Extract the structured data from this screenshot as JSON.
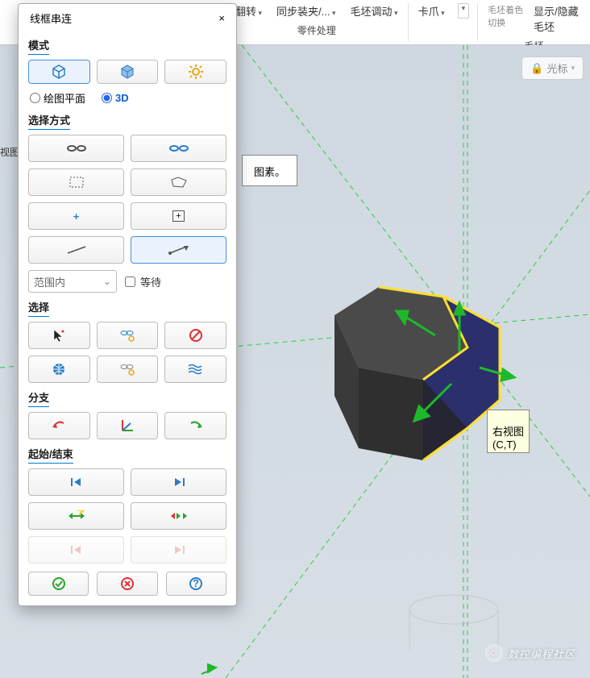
{
  "ribbon": {
    "group1": {
      "items": [
        "翻转",
        "同步装夹/...",
        "毛坯调动"
      ],
      "label": "零件处理"
    },
    "group2": {
      "items": [
        "卡爪"
      ],
      "label": ""
    },
    "group3": {
      "topLeft": "毛坯着色切换",
      "topRight": "显示/隐藏毛坯",
      "label": "毛坯"
    }
  },
  "cursor_btn": {
    "lock": "🔒",
    "label": "光标"
  },
  "left_sliver": "视图",
  "hint": "图素。",
  "tooltip": {
    "line1": "右视图",
    "line2": "(C,T)"
  },
  "watermark": "数控编程社区",
  "dialog": {
    "title": "线框串连",
    "mode": {
      "header": "模式",
      "radio_plane": "绘图平面",
      "radio_3d": "3D"
    },
    "select_method": {
      "header": "选择方式"
    },
    "range": {
      "combo": "范围内",
      "wait": "等待"
    },
    "selection": {
      "header": "选择"
    },
    "branches": {
      "header": "分支"
    },
    "startend": {
      "header": "起始/结束"
    }
  }
}
